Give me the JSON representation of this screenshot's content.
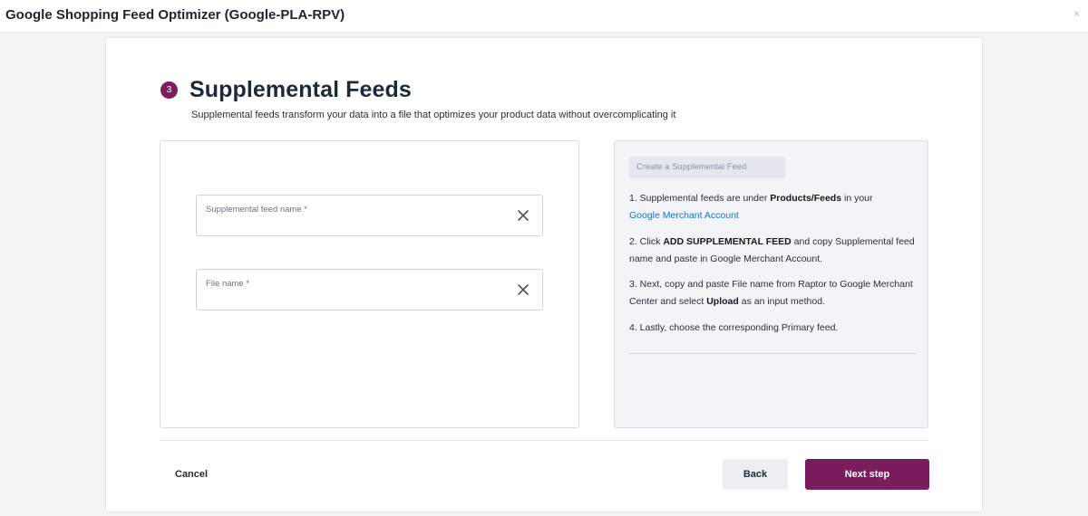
{
  "window": {
    "title": "Google Shopping Feed Optimizer (Google-PLA-RPV)",
    "close_glyph": "×"
  },
  "step": {
    "number": "3",
    "title": "Supplemental Feeds",
    "description": "Supplemental feeds transform your data into a file that optimizes your product data without overcomplicating it"
  },
  "form": {
    "fields": [
      {
        "label": "Supplemental feed name *",
        "value": "",
        "clear_icon": "close-icon"
      },
      {
        "label": "File name *",
        "value": "",
        "clear_icon": "close-icon"
      }
    ]
  },
  "instructions": {
    "header": "Create a Supplemental Feed",
    "steps": [
      {
        "pre": "1. Supplemental feeds are under ",
        "bold": "Products/Feeds",
        "post": " in your ",
        "link": "Google Merchant Account"
      },
      {
        "pre": "2. Click ",
        "bold": "ADD SUPPLEMENTAL FEED",
        "post": " and copy Supplemental feed name and paste in Google Merchant Account."
      },
      {
        "pre": "3. Next, copy and paste File name from Raptor to Google Merchant Center and select ",
        "bold": "Upload",
        "post": " as an input method."
      },
      {
        "text": "4. Lastly, choose the corresponding Primary feed."
      }
    ]
  },
  "footer": {
    "cancel_label": "Cancel",
    "back_label": "Back",
    "next_label": "Next step"
  },
  "colors": {
    "accent": "#7b1d5c",
    "link": "#1a73c9"
  }
}
